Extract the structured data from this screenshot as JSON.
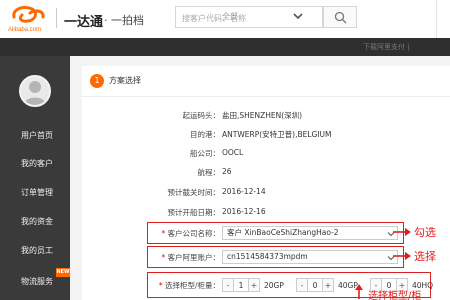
{
  "header": {
    "logo_text": "Alibaba.com",
    "brand": "一达通",
    "brand_sub": "· 一拍档",
    "search_placeholder": "搜客户代码、名称",
    "search_scope": "全部"
  },
  "topbar": {
    "link": "下载阿里支付 |"
  },
  "sidebar": {
    "items": [
      {
        "label": "用户首页"
      },
      {
        "label": "我的客户"
      },
      {
        "label": "订单管理"
      },
      {
        "label": "我的资金"
      },
      {
        "label": "我的员工"
      },
      {
        "label": "物流服务",
        "badge": "NEW"
      }
    ]
  },
  "step": {
    "number": "1",
    "title": "方案选择"
  },
  "form": {
    "fields": [
      {
        "label": "起运码头：",
        "value": "盐田,SHENZHEN(深圳)"
      },
      {
        "label": "目的港：",
        "value": "ANTWERP(安特卫普),BELGIUM"
      },
      {
        "label": "船公司：",
        "value": "OOCL"
      },
      {
        "label": "航程：",
        "value": "26"
      },
      {
        "label": "预计截关时间：",
        "value": "2016-12-14"
      },
      {
        "label": "预计开船日期：",
        "value": "2016-12-16"
      }
    ],
    "customer_name": {
      "label": "客户公司名称：",
      "value": "客户 XinBaoCeShiZhangHao-2"
    },
    "customer_account": {
      "label": "客户阿里账户：",
      "value": "cn1514584373mpdm"
    },
    "container": {
      "label": "选择柜型/柜量：",
      "items": [
        {
          "type": "20GP",
          "qty": "1"
        },
        {
          "type": "40GP",
          "qty": "0"
        },
        {
          "type": "40HQ",
          "qty": "0"
        }
      ]
    }
  },
  "annotations": {
    "a1": "勾选",
    "a2": "选择",
    "a3": "选择柜型/柜"
  }
}
